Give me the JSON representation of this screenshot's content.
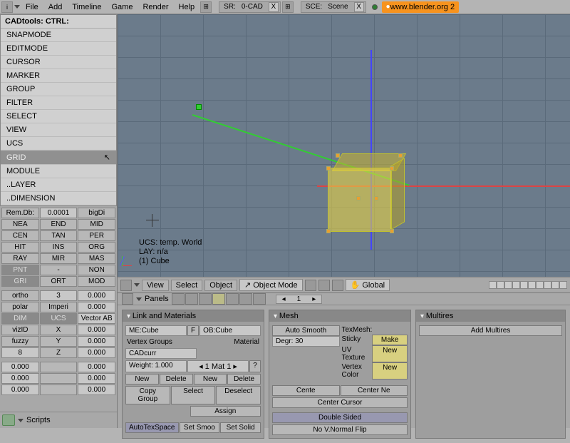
{
  "topmenu": [
    "File",
    "Add",
    "Timeline",
    "Game",
    "Render",
    "Help"
  ],
  "scene1": {
    "prefix": "SR:",
    "name": "0-CAD"
  },
  "scene2": {
    "prefix": "SCE:",
    "name": "Scene"
  },
  "url": "www.blender.org 2",
  "cad": {
    "title": "CADtools: CTRL:",
    "items": [
      "SNAPMODE",
      "EDITMODE",
      "CURSOR",
      "MARKER",
      "GROUP",
      "FILTER",
      "SELECT",
      "VIEW",
      "UCS",
      "GRID",
      "MODULE",
      "..LAYER",
      "..DIMENSION"
    ],
    "selected": "GRID"
  },
  "snapline": {
    "a": "Rem.Db:",
    "av": "0.0001",
    "b": "bigDi"
  },
  "snapgrid": [
    [
      "NEA",
      "END",
      "MID"
    ],
    [
      "CEN",
      "TAN",
      "PER"
    ],
    [
      "HIT",
      "INS",
      "ORG"
    ],
    [
      "RAY",
      "MIR",
      "MAS"
    ],
    [
      "PNT",
      "-",
      "NON"
    ],
    [
      "GRI",
      "ORT",
      "MOD"
    ]
  ],
  "coords": [
    [
      "ortho",
      "3",
      "0.000"
    ],
    [
      "polar",
      "Imperi",
      "0.000"
    ],
    [
      "DIM",
      "UCS",
      "Vector AB"
    ],
    [
      "vizID",
      "X",
      "0.000"
    ],
    [
      "fuzzy",
      "Y",
      "0.000"
    ],
    [
      "8",
      "Z",
      "0.000"
    ]
  ],
  "coords2": [
    [
      "0.000",
      "",
      "0.000"
    ],
    [
      "0.000",
      "",
      "0.000"
    ],
    [
      "0.000",
      "",
      "0.000"
    ]
  ],
  "scripts_label": "Scripts",
  "info": {
    "ucs": "UCS: temp. World",
    "lay": "LAY: n/a",
    "obj": "(1) Cube"
  },
  "v3d": {
    "menus": [
      "View",
      "Select",
      "Object"
    ],
    "mode": "Object Mode",
    "pivot": "Global"
  },
  "panels_hdr": {
    "label": "Panels",
    "page": "1"
  },
  "link": {
    "title": "Link and Materials",
    "me": "ME:Cube",
    "f": "F",
    "ob": "OB:Cube",
    "vg": "Vertex Groups",
    "mat": "Material",
    "cad": "CADcurr",
    "weight": "Weight: 1.000",
    "new": "New",
    "delete": "Delete",
    "copy": "Copy Group",
    "matpick": "1 Mat 1",
    "q": "?",
    "select": "Select",
    "deselect": "Deselect",
    "assign": "Assign",
    "autotex": "AutoTexSpace",
    "smoo": "Set Smoo",
    "solid": "Set Solid"
  },
  "mesh": {
    "title": "Mesh",
    "auto": "Auto Smooth",
    "degr": "Degr: 30",
    "centnew": "Center Ne",
    "cente": "Cente",
    "centcur": "Center Cursor",
    "double": "Double Sided",
    "noflip": "No V.Normal Flip",
    "texmesh": "TexMesh:",
    "sticky": "Sticky",
    "make": "Make",
    "uv": "UV Texture",
    "newbtn": "New",
    "vc": "Vertex Color"
  },
  "multires": {
    "title": "Multires",
    "add": "Add Multires"
  }
}
